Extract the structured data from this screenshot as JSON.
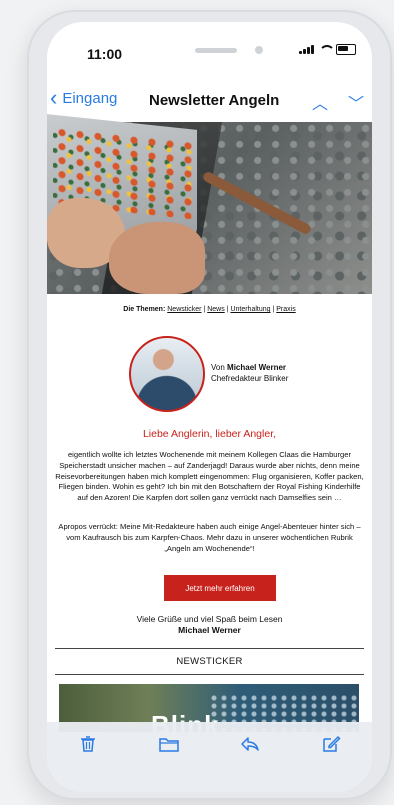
{
  "status_bar": {
    "time": "11:00"
  },
  "nav": {
    "back_label": "Eingang",
    "title": "Newsletter Angeln",
    "up_icon": "chevron-up-icon",
    "down_icon": "chevron-down-icon"
  },
  "email": {
    "themes_prefix": "Die Themen:",
    "themes": [
      "Newsticker",
      "News",
      "Unterhaltung",
      "Praxis"
    ],
    "author_by": "Von",
    "author_name": "Michael Werner",
    "author_role": "Chefredakteur Blinker",
    "greeting": "Liebe Anglerin, lieber Angler,",
    "paragraph1": "eigentlich wollte ich letztes Wochenende mit meinem Kollegen Claas die Hamburger Speicherstadt unsicher machen – auf Zanderjagd! Daraus wurde aber nichts, denn meine Reisevorbereitungen haben mich komplett eingenommen: Flug organisieren, Koffer packen, Fliegen binden. Wohin es geht? Ich bin mit den Botschaftern der Royal Fishing Kinderhilfe auf den Azoren! Die Karpfen dort sollen ganz verrückt nach Damselfies sein …",
    "paragraph2": "Apropos verrückt: Meine Mit-Redakteure haben auch einige Angel-Abenteuer hinter sich – vom Kaufrausch bis zum Karpfen-Chaos. Mehr dazu in unserer wöchentlichen Rubrik „Angeln am Wochenende“!",
    "cta_label": "Jetzt mehr erfahren",
    "closing": "Viele Grüße und viel Spaß beim Lesen",
    "signature": "Michael Werner",
    "section_title": "NEWSTICKER",
    "thumb_logo_text": "Blink"
  },
  "toolbar": {
    "trash_icon": "trash-icon",
    "folder_icon": "folder-icon",
    "reply_icon": "reply-icon",
    "compose_icon": "compose-icon"
  },
  "colors": {
    "accent": "#2a7be4",
    "brand_red": "#c8221c"
  }
}
